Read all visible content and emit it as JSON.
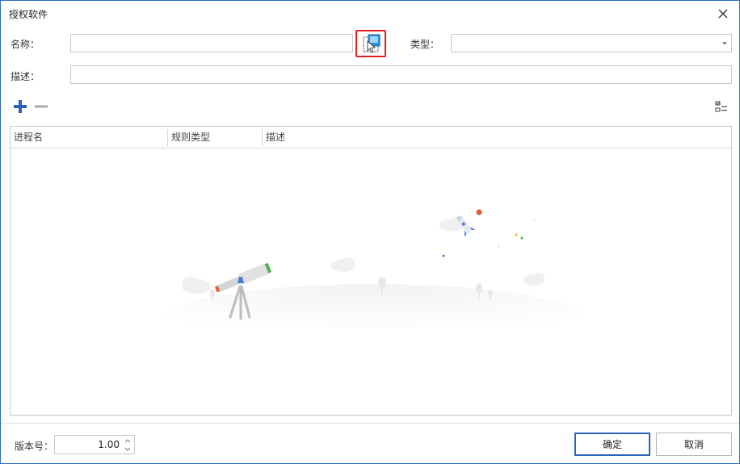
{
  "window": {
    "title": "授权软件"
  },
  "form": {
    "name_label": "名称：",
    "name_value": "",
    "type_label": "类型：",
    "type_value": "",
    "desc_label": "描述：",
    "desc_value": ""
  },
  "toolbar": {
    "add_icon": "plus-icon",
    "remove_icon": "minus-icon",
    "columns_icon": "column-chooser-icon"
  },
  "grid": {
    "columns": [
      "进程名",
      "规则类型",
      "描述"
    ],
    "rows": []
  },
  "footer": {
    "version_label": "版本号：",
    "version_value": "1.00",
    "ok_label": "确定",
    "cancel_label": "取消"
  },
  "colors": {
    "accent": "#2a63b8",
    "highlight": "#e02020",
    "add": "#2a63b8",
    "remove": "#a8a8a8"
  }
}
